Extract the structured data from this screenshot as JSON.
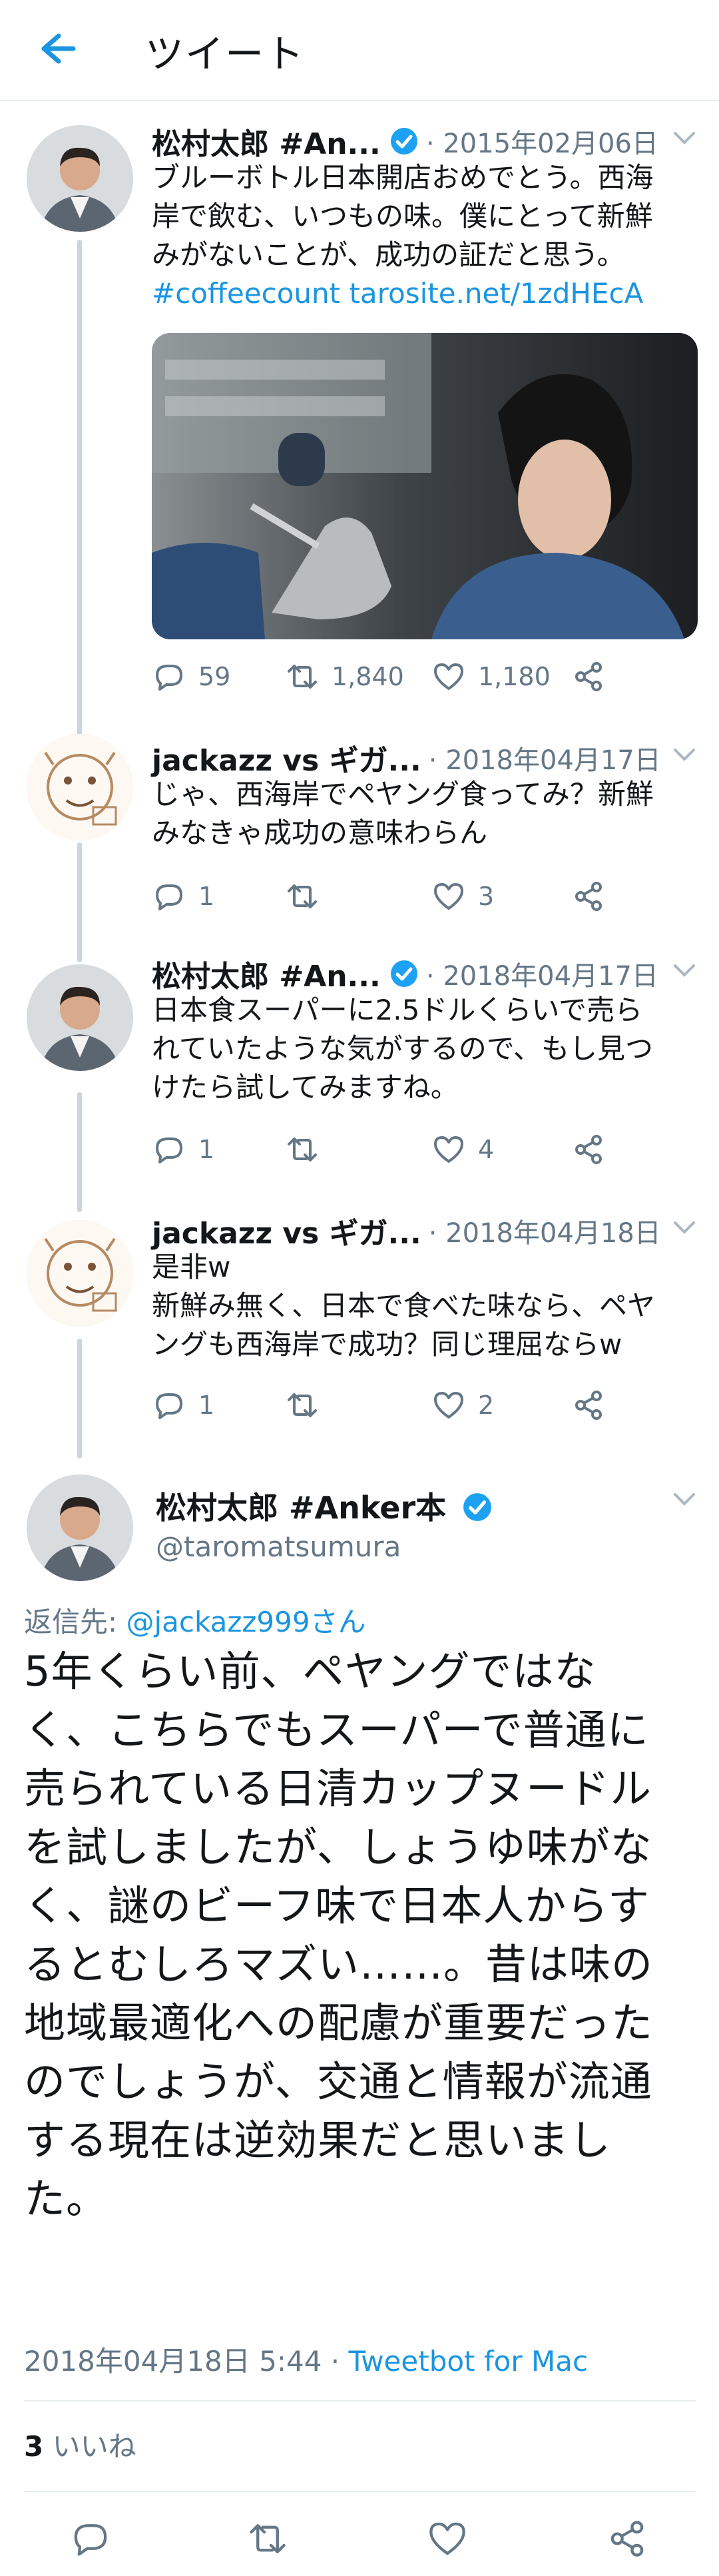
{
  "header": {
    "title": "ツイート",
    "back_icon": "arrow-left-icon"
  },
  "colors": {
    "accent": "#1b95e0",
    "text": "#14171a",
    "muted": "#657786",
    "divider": "#e6ecf0",
    "thread_line": "#c8d6df"
  },
  "thread": [
    {
      "name": "松村太郎 #An...",
      "verified": true,
      "date": "· 2015年02月06日",
      "text_lines": [
        "ブルーボトル日本開店おめでとう。西海",
        "岸で飲む、いつもの味。僕にとって新鮮",
        "みがないことが、成功の証だと思う。"
      ],
      "hashtag": "#coffeecount",
      "url": "tarosite.net/1zdHEcA",
      "has_media": true,
      "replies": "59",
      "retweets": "1,840",
      "likes": "1,180"
    },
    {
      "name": "jackazz vs ギガ...",
      "verified": false,
      "date": "· 2018年04月17日",
      "text_lines": [
        "じゃ、西海岸でペヤング食ってみ？新鮮",
        "みなきゃ成功の意味わらん"
      ],
      "replies": "1",
      "retweets": "",
      "likes": "3"
    },
    {
      "name": "松村太郎 #An...",
      "verified": true,
      "date": "· 2018年04月17日",
      "text_lines": [
        "日本食スーパーに2.5ドルくらいで売ら",
        "れていたような気がするので、もし見つ",
        "けたら試してみますね。"
      ],
      "replies": "1",
      "retweets": "",
      "likes": "4"
    },
    {
      "name": "jackazz vs ギガ...",
      "verified": false,
      "date": "· 2018年04月18日",
      "text_lines": [
        "是非w",
        "新鮮み無く、日本で食べた味なら、ペヤ",
        "ングも西海岸で成功？同じ理屈ならw"
      ],
      "replies": "1",
      "retweets": "",
      "likes": "2"
    }
  ],
  "main_tweet": {
    "name": "松村太郎 #Anker本",
    "handle": "@taromatsumura",
    "reply_prefix": "返信先: ",
    "reply_target": "@jackazz999さん",
    "text_lines": [
      "5年くらい前、ペヤングではな",
      "く、こちらでもスーパーで普通に",
      "売られている日清カップヌードル",
      "を試しましたが、しょうゆ味がな",
      "く、謎のビーフ味で日本人からす",
      "るとむしろマズい……。昔は味の",
      "地域最適化への配慮が重要だった",
      "のでしょうが、交通と情報が流通",
      "する現在は逆効果だと思いまし",
      "た。"
    ],
    "timestamp": "2018年04月18日 5:44 · ",
    "client": "Tweetbot for Mac",
    "like_count": "3",
    "like_label": " いいね"
  },
  "icons": {
    "reply": "reply-icon",
    "retweet": "retweet-icon",
    "like": "heart-icon",
    "share": "share-icon",
    "caret": "chevron-down-icon",
    "verified": "verified-badge-icon"
  }
}
